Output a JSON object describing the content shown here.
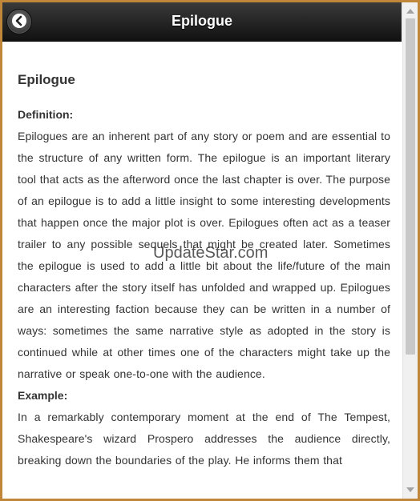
{
  "header": {
    "title": "Epilogue"
  },
  "content": {
    "heading": "Epilogue",
    "definition_label": "Definition:",
    "definition_text": "Epilogues are an inherent part of any story or poem and are essential to the structure of any written form. The epilogue is an important literary tool that acts as the afterword once the last chapter is over. The purpose of an epilogue is to add a little insight to some interesting developments that happen once the major plot is over. Epilogues often act as a teaser trailer to any possible sequels that might be created later. Sometimes the epilogue is used to add a little bit about the life/future of the main characters after the story itself has unfolded and wrapped up. Epilogues are an interesting faction because they can be written in a number of ways: sometimes the same narrative style as adopted in the story is continued while at other times one of the characters might take up the narrative or speak one-to-one with the audience.",
    "example_label": "Example:",
    "example_text": "In a remarkably contemporary moment at the end of The Tempest, Shakespeare's wizard Prospero addresses the audience directly, breaking down the boundaries of the play. He informs them that"
  },
  "watermark": "UpdateStar.com",
  "icons": {
    "back": "chevron-left-circle-icon",
    "scroll_up": "arrow-up-icon",
    "scroll_down": "arrow-down-icon"
  },
  "colors": {
    "header_bg": "#1a1a1a",
    "frame_border": "#c0873a",
    "text": "#333333"
  }
}
